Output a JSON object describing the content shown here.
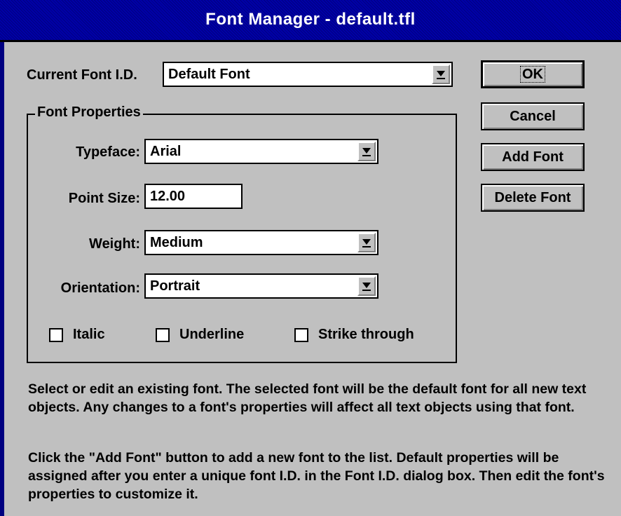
{
  "window": {
    "title": "Font Manager - default.tfl"
  },
  "current_font": {
    "label": "Current Font I.D.",
    "value": "Default Font"
  },
  "group": {
    "title": "Font Properties"
  },
  "typeface": {
    "label": "Typeface:",
    "value": "Arial"
  },
  "point_size": {
    "label": "Point Size:",
    "value": "12.00"
  },
  "weight": {
    "label": "Weight:",
    "value": "Medium"
  },
  "orientation": {
    "label": "Orientation:",
    "value": "Portrait"
  },
  "checkboxes": {
    "italic": {
      "label": "Italic",
      "checked": false
    },
    "underline": {
      "label": "Underline",
      "checked": false
    },
    "strike": {
      "label": "Strike through",
      "checked": false
    }
  },
  "buttons": {
    "ok": "OK",
    "cancel": "Cancel",
    "add_font": "Add Font",
    "delete_font": "Delete Font"
  },
  "help": {
    "para1": "Select or edit an existing font.  The selected font will be the default font for all new text objects.  Any changes to a font's properties will affect all text objects using that font.",
    "para2": "Click the \"Add Font\" button to add a new font to the list.  Default properties will be assigned after you enter a unique font I.D. in the Font I.D. dialog box.  Then edit the font's properties to customize it."
  },
  "icons": {
    "dropdown": "dropdown-arrow-icon"
  },
  "colors": {
    "title_bar": "#000080",
    "face": "#c0c0c0"
  }
}
